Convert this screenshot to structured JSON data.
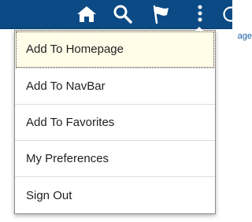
{
  "header": {
    "bar_color": "#0b4a84",
    "icons": [
      {
        "name": "home-icon"
      },
      {
        "name": "search-icon"
      },
      {
        "name": "flag-icon"
      },
      {
        "name": "vertical-ellipsis-icon"
      },
      {
        "name": "navbar-compass-icon"
      }
    ]
  },
  "background": {
    "partial_link_text": "age"
  },
  "actions_menu": {
    "items": [
      {
        "label": "Add To Homepage",
        "focused": true
      },
      {
        "label": "Add To NavBar"
      },
      {
        "label": "Add To Favorites"
      },
      {
        "label": "My Preferences"
      },
      {
        "label": "Sign Out"
      }
    ]
  }
}
